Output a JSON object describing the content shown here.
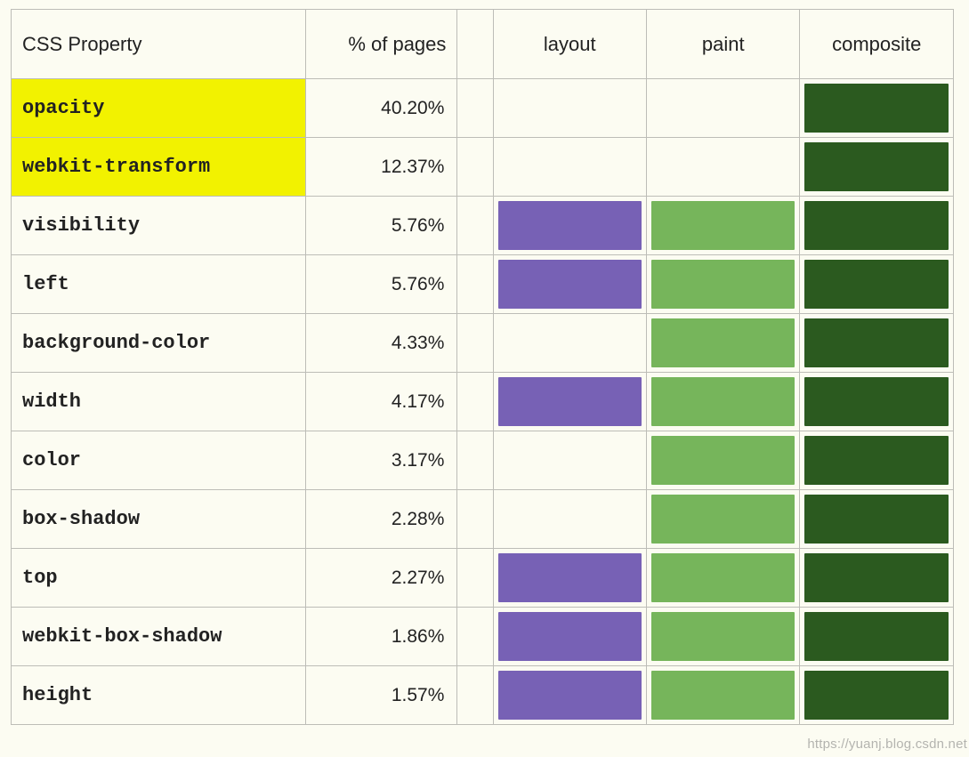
{
  "headers": {
    "property": "CSS Property",
    "percent": "% of pages",
    "layout": "layout",
    "paint": "paint",
    "composite": "composite"
  },
  "colors": {
    "layout": "#7761b5",
    "paint": "#76b55b",
    "composite": "#2b5a1f",
    "highlight": "#f2f200"
  },
  "rows": [
    {
      "property": "opacity",
      "percent": "40.20%",
      "highlight": true,
      "layout": false,
      "paint": false,
      "composite": true
    },
    {
      "property": "webkit-transform",
      "percent": "12.37%",
      "highlight": true,
      "layout": false,
      "paint": false,
      "composite": true
    },
    {
      "property": "visibility",
      "percent": "5.76%",
      "highlight": false,
      "layout": true,
      "paint": true,
      "composite": true
    },
    {
      "property": "left",
      "percent": "5.76%",
      "highlight": false,
      "layout": true,
      "paint": true,
      "composite": true
    },
    {
      "property": "background-color",
      "percent": "4.33%",
      "highlight": false,
      "layout": false,
      "paint": true,
      "composite": true
    },
    {
      "property": "width",
      "percent": "4.17%",
      "highlight": false,
      "layout": true,
      "paint": true,
      "composite": true
    },
    {
      "property": "color",
      "percent": "3.17%",
      "highlight": false,
      "layout": false,
      "paint": true,
      "composite": true
    },
    {
      "property": "box-shadow",
      "percent": "2.28%",
      "highlight": false,
      "layout": false,
      "paint": true,
      "composite": true
    },
    {
      "property": "top",
      "percent": "2.27%",
      "highlight": false,
      "layout": true,
      "paint": true,
      "composite": true
    },
    {
      "property": "webkit-box-shadow",
      "percent": "1.86%",
      "highlight": false,
      "layout": true,
      "paint": true,
      "composite": true
    },
    {
      "property": "height",
      "percent": "1.57%",
      "highlight": false,
      "layout": true,
      "paint": true,
      "composite": true
    }
  ],
  "watermark": "https://yuanj.blog.csdn.net",
  "chart_data": {
    "type": "table",
    "title": "CSS Property rendering cost",
    "columns": [
      "CSS Property",
      "% of pages",
      "layout",
      "paint",
      "composite"
    ],
    "rows": [
      [
        "opacity",
        40.2,
        false,
        false,
        true
      ],
      [
        "webkit-transform",
        12.37,
        false,
        false,
        true
      ],
      [
        "visibility",
        5.76,
        true,
        true,
        true
      ],
      [
        "left",
        5.76,
        true,
        true,
        true
      ],
      [
        "background-color",
        4.33,
        false,
        true,
        true
      ],
      [
        "width",
        4.17,
        true,
        true,
        true
      ],
      [
        "color",
        3.17,
        false,
        true,
        true
      ],
      [
        "box-shadow",
        2.28,
        false,
        true,
        true
      ],
      [
        "top",
        2.27,
        true,
        true,
        true
      ],
      [
        "webkit-box-shadow",
        1.86,
        true,
        true,
        true
      ],
      [
        "height",
        1.57,
        true,
        true,
        true
      ]
    ]
  }
}
